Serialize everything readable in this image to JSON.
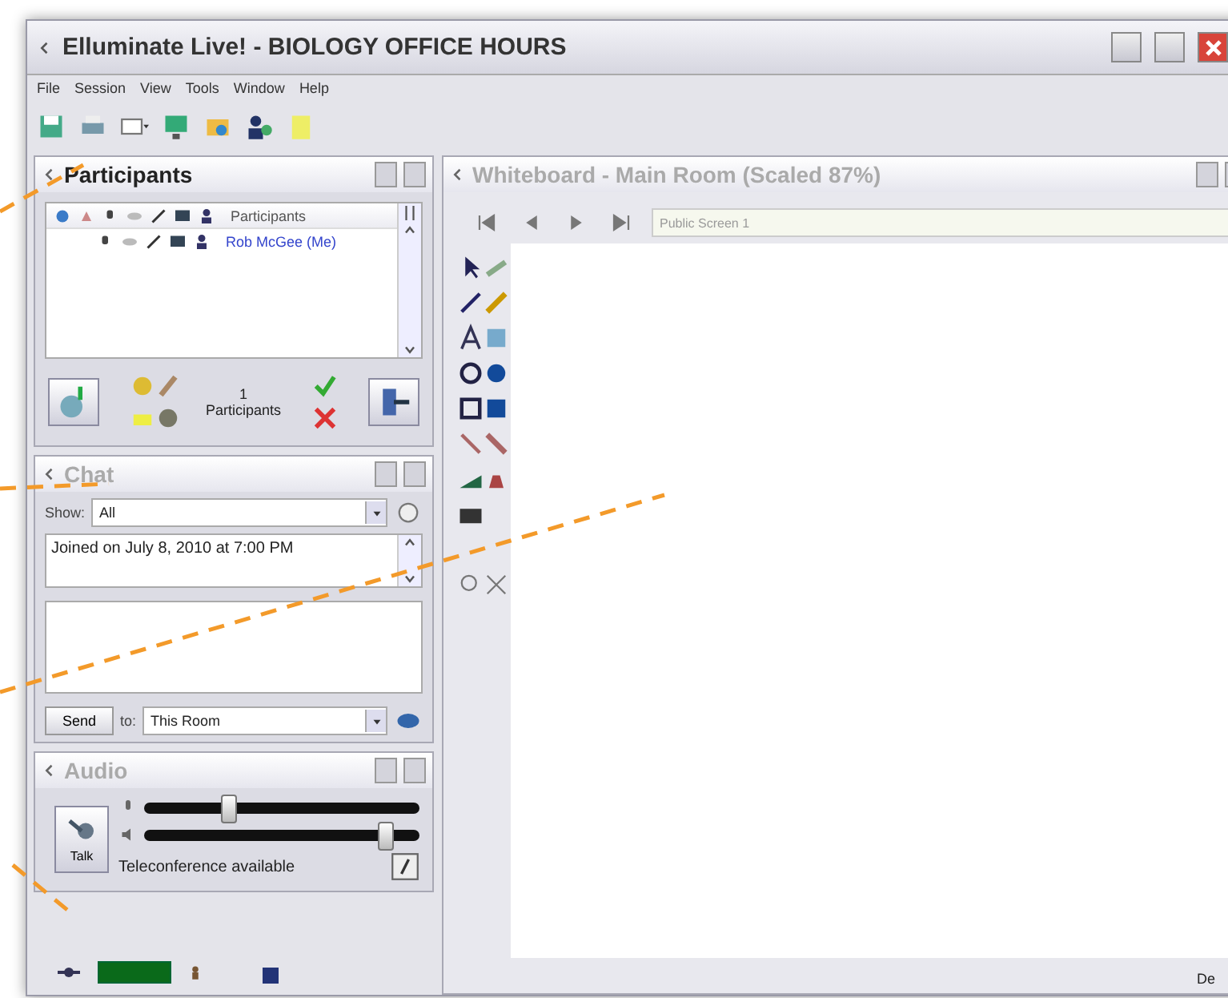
{
  "window": {
    "title": "Elluminate Live! - BIOLOGY OFFICE HOURS"
  },
  "menu": [
    "File",
    "Session",
    "View",
    "Tools",
    "Window",
    "Help"
  ],
  "participants": {
    "title": "Participants",
    "active": true,
    "column_header": "Participants",
    "rows": [
      {
        "name": "Rob McGee (Me)"
      }
    ],
    "count": "1",
    "count_label": "Participants"
  },
  "chat": {
    "title": "Chat",
    "active": false,
    "show_label": "Show:",
    "show_value": "All",
    "messages": [
      "Joined on July 8, 2010 at 7:00 PM"
    ],
    "send": "Send",
    "to_label": "to:",
    "to_value": "This Room"
  },
  "audio": {
    "title": "Audio",
    "active": false,
    "talk": "Talk",
    "microphone": {
      "level": 0.3
    },
    "speaker": {
      "level": 0.87
    },
    "status": "Teleconference available"
  },
  "whiteboard": {
    "title": "Whiteboard - Main Room (Scaled 87%)",
    "active": false,
    "screen": "Public Screen 1"
  },
  "status_bar": {
    "text": "De"
  }
}
